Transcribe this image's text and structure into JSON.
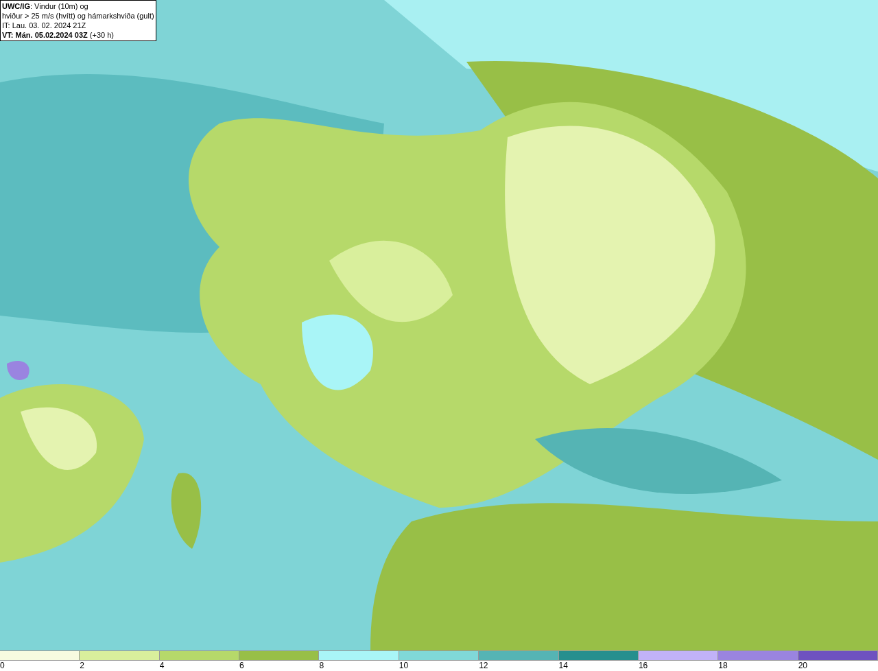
{
  "title_box": {
    "lines": [
      "**UWC/IG**: Vindur (10m) og",
      "hviður > 25 m/s (hvítt) og hámarkshviða (gult)",
      "IT: Lau. 03. 02. 2024 21Z",
      "**VT: Mán. 05.02.2024 03Z** (+30 h)"
    ]
  },
  "legend": {
    "swatches": [
      {
        "color": "#f7fbe0"
      },
      {
        "color": "#d9ef9c"
      },
      {
        "color": "#b6d96a"
      },
      {
        "color": "#98bf47"
      },
      {
        "color": "#a9f5f7"
      },
      {
        "color": "#80d8d8"
      },
      {
        "color": "#55b4b4"
      },
      {
        "color": "#268f8e"
      },
      {
        "color": "#c1b2f8"
      },
      {
        "color": "#9a84e0"
      },
      {
        "color": "#6e52c0"
      }
    ],
    "ticks": [
      "0",
      "2",
      "4",
      "6",
      "8",
      "10",
      "12",
      "14",
      "16",
      "18",
      "20"
    ]
  }
}
